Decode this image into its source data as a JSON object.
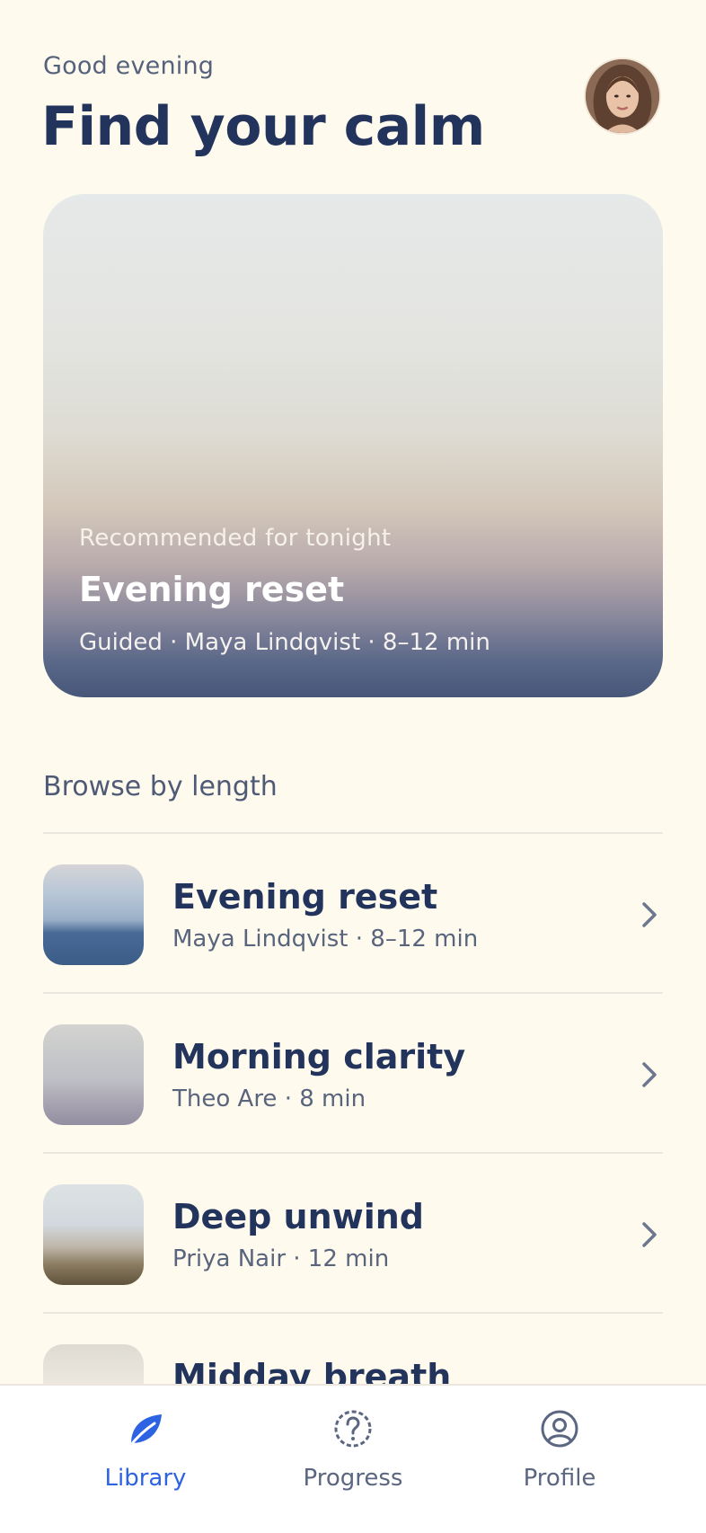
{
  "header": {
    "greeting": "Good evening",
    "title": "Find your calm",
    "avatar_icon": "user-avatar-photo"
  },
  "featured": {
    "eyebrow": "Recommended for tonight",
    "title": "Evening reset",
    "meta": "Guided · Maya Lindqvist · 8–12 min"
  },
  "browse": {
    "section_title": "Browse by length",
    "items": [
      {
        "title": "Evening reset",
        "subtitle": "Maya Lindqvist · 8–12 min",
        "icon": "chevron-right-icon"
      },
      {
        "title": "Morning clarity",
        "subtitle": "Theo Are · 8 min",
        "icon": "chevron-right-icon"
      },
      {
        "title": "Deep unwind",
        "subtitle": "Priya Nair · 12 min",
        "icon": "chevron-right-icon"
      },
      {
        "title": "Midday breath",
        "subtitle": "",
        "icon": "chevron-right-icon"
      }
    ]
  },
  "tabbar": {
    "tabs": [
      {
        "label": "Library",
        "icon": "leaf-icon",
        "active": true
      },
      {
        "label": "Progress",
        "icon": "question-circle-icon",
        "active": false
      },
      {
        "label": "Profile",
        "icon": "user-circle-icon",
        "active": false
      }
    ],
    "active_color": "#2d63e2",
    "inactive_color": "#5b6680"
  },
  "colors": {
    "background": "#fefaee",
    "heading": "#23345c",
    "accent": "#2d63e2"
  }
}
